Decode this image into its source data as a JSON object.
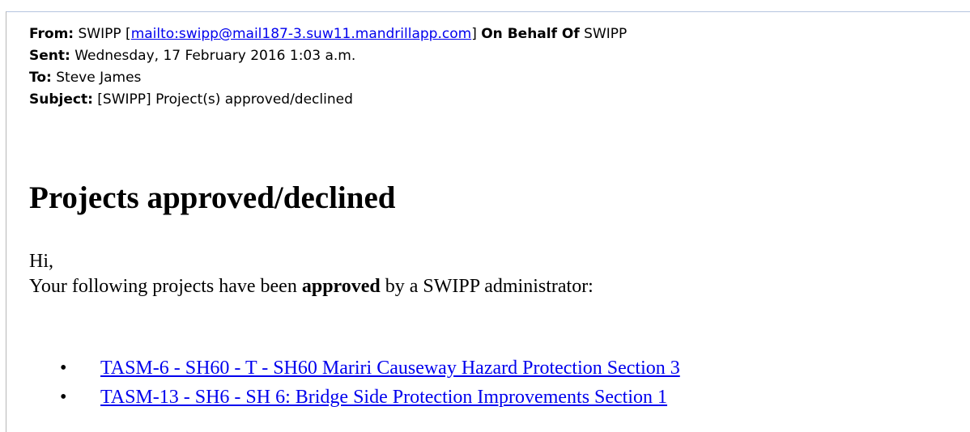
{
  "email": {
    "from_label": "From:",
    "from_name": "SWIPP",
    "from_bracket_open": "[",
    "from_link": "mailto:swipp@mail187-3.suw11.mandrillapp.com",
    "from_bracket_close": "]",
    "on_behalf_label": "On Behalf Of",
    "on_behalf_name": "SWIPP",
    "sent_label": "Sent:",
    "sent_value": "Wednesday, 17 February 2016 1:03 a.m.",
    "to_label": "To:",
    "to_value": "Steve James",
    "subject_label": "Subject:",
    "subject_value": "[SWIPP] Project(s) approved/declined"
  },
  "content": {
    "heading": "Projects approved/declined",
    "greeting": "Hi,",
    "intro_before": "Your following projects have been",
    "intro_bold": "approved",
    "intro_after": "by a SWIPP administrator:",
    "bullet": "•",
    "projects": [
      {
        "label": "TASM-6 - SH60 - T - SH60 Mariri Causeway Hazard Protection Section 3"
      },
      {
        "label": "TASM-13 - SH6 - SH 6: Bridge Side Protection Improvements Section 1"
      }
    ]
  },
  "colors": {
    "link": "#0000ee",
    "top_rule": "#b5c4df",
    "left_rule": "#b7b7b7"
  }
}
